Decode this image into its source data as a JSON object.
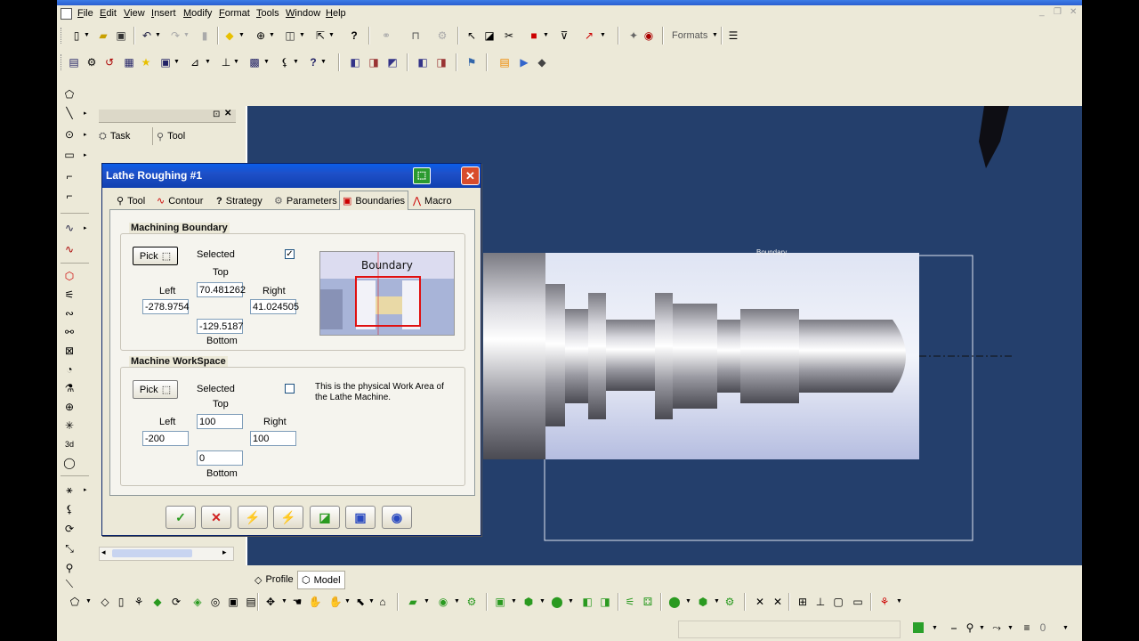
{
  "menu": [
    "File",
    "Edit",
    "View",
    "Insert",
    "Modify",
    "Format",
    "Tools",
    "Window",
    "Help"
  ],
  "toolbar": {
    "formats_label": "Formats"
  },
  "panel": {
    "tabs": [
      {
        "label": "Task",
        "icon": "task-icon"
      },
      {
        "label": "Tool",
        "icon": "tool-icon"
      }
    ]
  },
  "dialog": {
    "title": "Lathe Roughing #1",
    "tabs": [
      {
        "label": "Tool",
        "icon": "tool-icon"
      },
      {
        "label": "Contour",
        "icon": "contour-icon"
      },
      {
        "label": "Strategy",
        "icon": "strategy-icon"
      },
      {
        "label": "Parameters",
        "icon": "parameters-icon"
      },
      {
        "label": "Boundaries",
        "icon": "boundaries-icon"
      },
      {
        "label": "Macro",
        "icon": "macro-icon"
      }
    ],
    "active_tab": "Boundaries",
    "machining_boundary": {
      "title": "Machining Boundary",
      "pick_label": "Pick",
      "selected_label": "Selected",
      "selected_checked": true,
      "top_label": "Top",
      "top_value": "70.481262",
      "left_label": "Left",
      "left_value": "-278.9754",
      "right_label": "Right",
      "right_value": "41.024505",
      "bottom_value": "-129.5187",
      "bottom_label": "Bottom",
      "preview_label": "Boundary"
    },
    "machine_workspace": {
      "title": "Machine WorkSpace",
      "pick_label": "Pick",
      "selected_label": "Selected",
      "selected_checked": false,
      "note": "This is the physical Work Area of the Lathe Machine.",
      "top_label": "Top",
      "top_value": "100",
      "left_label": "Left",
      "left_value": "-200",
      "right_label": "Right",
      "right_value": "100",
      "bottom_value": "0",
      "bottom_label": "Bottom"
    }
  },
  "viewport": {
    "boundary_label": "Boundary",
    "background": "#243f6c"
  },
  "bottom_tabs": [
    {
      "label": "Profile"
    },
    {
      "label": "Model"
    }
  ],
  "colors": {
    "title_blue": "#0a5de8",
    "viewport_bg": "#243f6c",
    "chrome": "#ece9d8"
  }
}
